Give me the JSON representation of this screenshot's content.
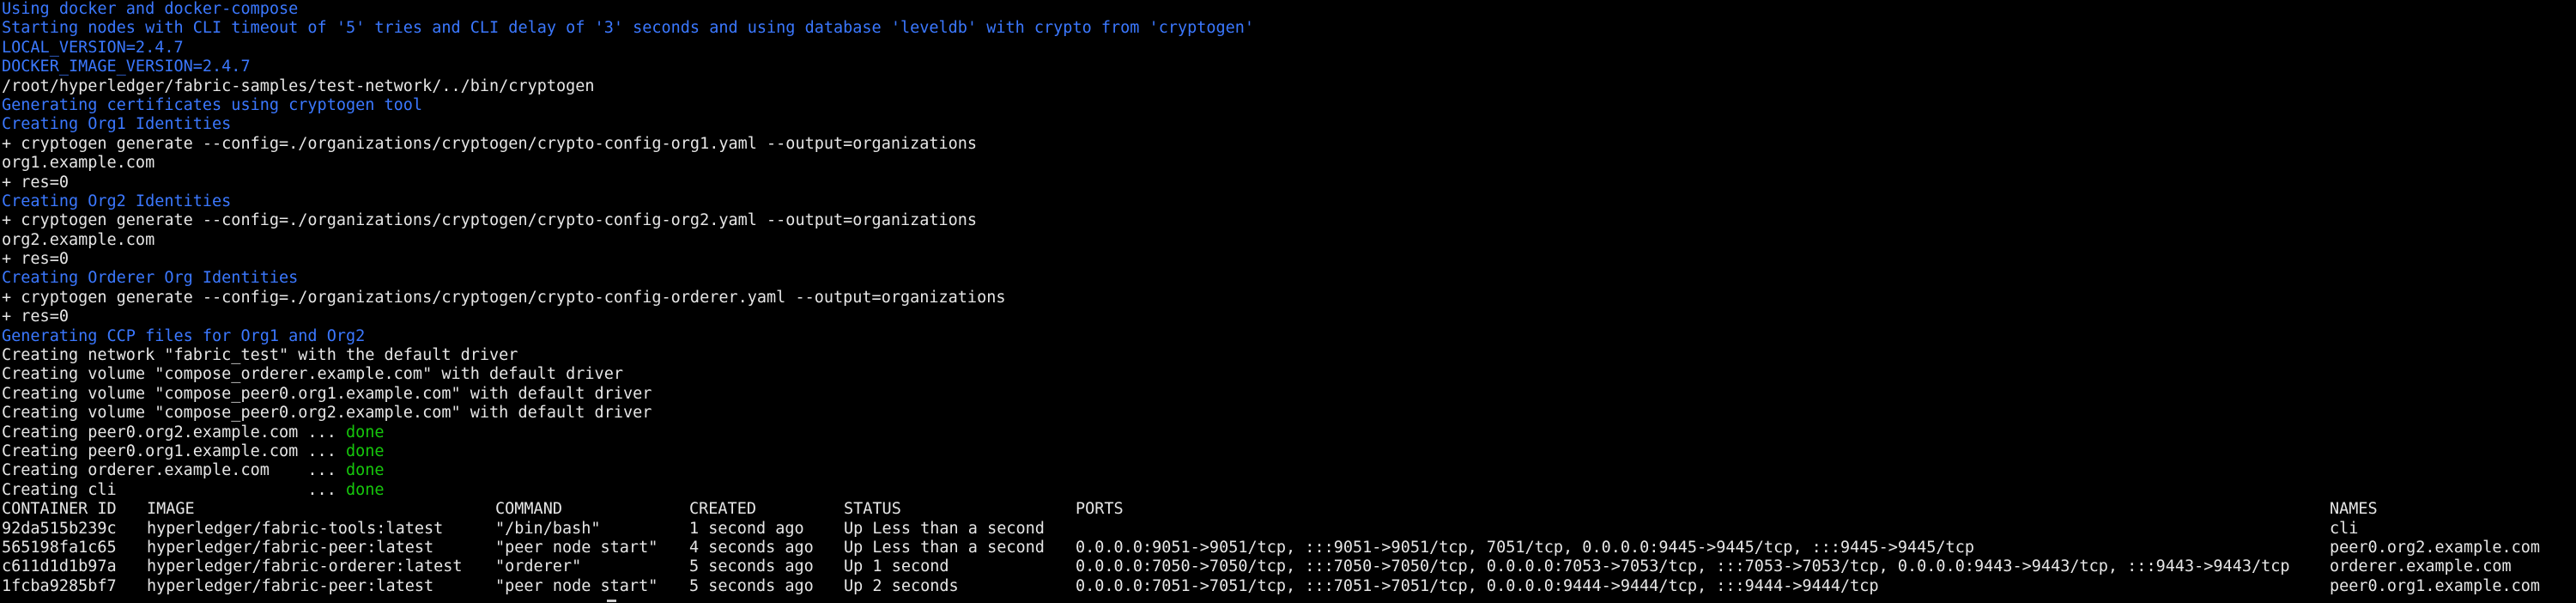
{
  "terminal": {
    "lines": [
      {
        "text": "Using docker and docker-compose",
        "color": "blue"
      },
      {
        "text": "Starting nodes with CLI timeout of '5' tries and CLI delay of '3' seconds and using database 'leveldb' with crypto from 'cryptogen'",
        "color": "blue"
      },
      {
        "text": "LOCAL_VERSION=2.4.7",
        "color": "blue"
      },
      {
        "text": "DOCKER_IMAGE_VERSION=2.4.7",
        "color": "blue"
      },
      {
        "text": "/root/hyperledger/fabric-samples/test-network/../bin/cryptogen",
        "color": "white"
      },
      {
        "text": "Generating certificates using cryptogen tool",
        "color": "blue"
      },
      {
        "text": "Creating Org1 Identities",
        "color": "blue"
      },
      {
        "text": "+ cryptogen generate --config=./organizations/cryptogen/crypto-config-org1.yaml --output=organizations",
        "color": "white"
      },
      {
        "text": "org1.example.com",
        "color": "white"
      },
      {
        "text": "+ res=0",
        "color": "white"
      },
      {
        "text": "Creating Org2 Identities",
        "color": "blue"
      },
      {
        "text": "+ cryptogen generate --config=./organizations/cryptogen/crypto-config-org2.yaml --output=organizations",
        "color": "white"
      },
      {
        "text": "org2.example.com",
        "color": "white"
      },
      {
        "text": "+ res=0",
        "color": "white"
      },
      {
        "text": "Creating Orderer Org Identities",
        "color": "blue"
      },
      {
        "text": "+ cryptogen generate --config=./organizations/cryptogen/crypto-config-orderer.yaml --output=organizations",
        "color": "white"
      },
      {
        "text": "+ res=0",
        "color": "white"
      },
      {
        "text": "Generating CCP files for Org1 and Org2",
        "color": "blue"
      },
      {
        "text": "Creating network \"fabric_test\" with the default driver",
        "color": "white"
      },
      {
        "text": "Creating volume \"compose_orderer.example.com\" with default driver",
        "color": "white"
      },
      {
        "text": "Creating volume \"compose_peer0.org1.example.com\" with default driver",
        "color": "white"
      },
      {
        "text": "Creating volume \"compose_peer0.org2.example.com\" with default driver",
        "color": "white"
      }
    ],
    "creating": [
      {
        "prefix": "Creating peer0.org2.example.com ... ",
        "status": "done"
      },
      {
        "prefix": "Creating peer0.org1.example.com ... ",
        "status": "done"
      },
      {
        "prefix": "Creating orderer.example.com    ... ",
        "status": "done"
      },
      {
        "prefix": "Creating cli                    ... ",
        "status": "done"
      }
    ],
    "table": {
      "headers": [
        "CONTAINER ID",
        "IMAGE",
        "COMMAND",
        "CREATED",
        "STATUS",
        "PORTS",
        "NAMES"
      ],
      "rows": [
        [
          "92da515b239c",
          "hyperledger/fabric-tools:latest",
          "\"/bin/bash\"",
          "1 second ago",
          "Up Less than a second",
          "",
          "cli"
        ],
        [
          "565198fa1c65",
          "hyperledger/fabric-peer:latest",
          "\"peer node start\"",
          "4 seconds ago",
          "Up Less than a second",
          "0.0.0.0:9051->9051/tcp, :::9051->9051/tcp, 7051/tcp, 0.0.0.0:9445->9445/tcp, :::9445->9445/tcp",
          "peer0.org2.example.com"
        ],
        [
          "c611d1d1b97a",
          "hyperledger/fabric-orderer:latest",
          "\"orderer\"",
          "5 seconds ago",
          "Up 1 second",
          "0.0.0.0:7050->7050/tcp, :::7050->7050/tcp, 0.0.0.0:7053->7053/tcp, :::7053->7053/tcp, 0.0.0.0:9443->9443/tcp, :::9443->9443/tcp",
          "orderer.example.com"
        ],
        [
          "1fcba9285bf7",
          "hyperledger/fabric-peer:latest",
          "\"peer node start\"",
          "5 seconds ago",
          "Up 2 seconds",
          "0.0.0.0:7051->7051/tcp, :::7051->7051/tcp, 0.0.0.0:9444->9444/tcp, :::9444->9444/tcp",
          "peer0.org1.example.com"
        ]
      ]
    }
  },
  "colors": {
    "background": "#000000",
    "text": "#e6e6e6",
    "info": "#3b78ff",
    "success": "#16c60c"
  }
}
